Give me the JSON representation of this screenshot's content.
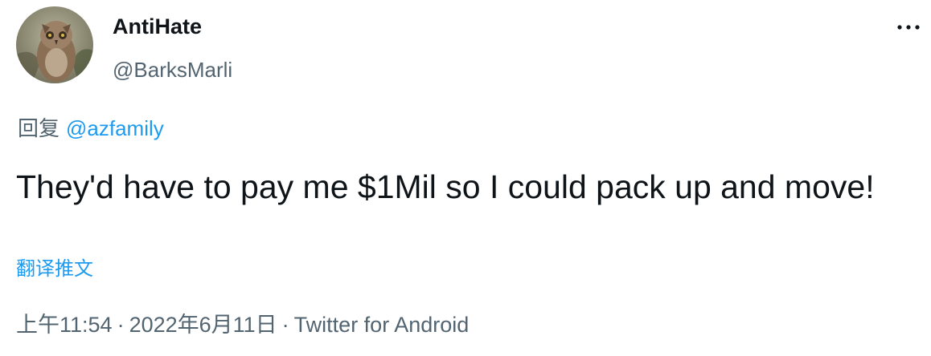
{
  "author": {
    "display_name": "AntiHate",
    "handle": "@BarksMarli",
    "avatar_icon": "owl-avatar-icon"
  },
  "menu": {
    "more_icon": "more-dots-icon"
  },
  "reply": {
    "prefix": "回复",
    "mention": "@azfamily"
  },
  "tweet": {
    "text": "They'd have to pay me $1Mil so I could pack up and move!",
    "translate_label": "翻译推文"
  },
  "meta": {
    "time": "上午11:54",
    "separator": "·",
    "date": "2022年6月11日",
    "source": "Twitter for Android"
  },
  "colors": {
    "text_primary": "#0f1419",
    "text_secondary": "#536471",
    "link": "#1d9bf0"
  }
}
